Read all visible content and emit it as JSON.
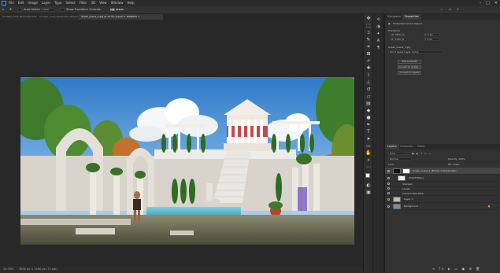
{
  "app": {
    "menu": [
      "File",
      "Edit",
      "Image",
      "Layer",
      "Type",
      "Select",
      "Filter",
      "3D",
      "View",
      "Window",
      "Help"
    ],
    "window_controls": [
      "–",
      "□",
      "✕"
    ]
  },
  "options_bar": {
    "auto_select_label": "Auto-Select:",
    "auto_select_value": "Layer",
    "transform_label": "Show Transform Controls"
  },
  "tabs": [
    {
      "label": "Ancient_ruins_landscape.psd @ 16.7% (Ruins, RGB/8) ×",
      "active": false
    },
    {
      "label": "Ancient_ruins_landscape_02.psd @ 16.7% (Grass, RGB/8) ×",
      "active": false
    },
    {
      "label": "Greek_scene_1.jpg @ 33.3% (Layer 3, RGB/8#) ×",
      "active": true
    }
  ],
  "status_bar": {
    "zoom": "33.33%",
    "doc_info": "3840 px × 2160 px (72 ppi)"
  },
  "toolbar": {
    "tools": [
      "move-icon",
      "marquee-icon",
      "lasso-icon",
      "quick-select-icon",
      "crop-icon",
      "frame-icon",
      "eyedropper-icon",
      "healing-icon",
      "brush-icon",
      "stamp-icon",
      "history-brush-icon",
      "eraser-icon",
      "gradient-icon",
      "blur-icon",
      "dodge-icon",
      "pen-icon",
      "type-icon",
      "path-select-icon",
      "rectangle-icon",
      "hand-icon",
      "zoom-icon"
    ],
    "foreground_color": "#ffffff",
    "background_color": "#000000"
  },
  "properties_panel": {
    "tabs": [
      "Navigator",
      "Properties"
    ],
    "active_tab": "Properties",
    "header": "Embedded Smart Object",
    "section_transform": "Transform",
    "w_value": "W: 3840 px",
    "h_value": "H: 2160 px",
    "x_value": "X: 0 px",
    "y_value": "Y: 0 px",
    "file_link": "Greek_scene_1.jpg",
    "layer_comp": "Don't Apply Layer Comp",
    "buttons": [
      "Edit Contents",
      "Convert to Linked...",
      "Convert to Layers"
    ]
  },
  "layers_panel": {
    "tabs": [
      "Layers",
      "Channels",
      "Paths"
    ],
    "active_tab": "Layers",
    "kind_filter": "Kind",
    "blend_mode": "Normal",
    "opacity": "Opacity: 100%",
    "fill": "Fill: 100%",
    "lock_label": "Lock:",
    "layers": [
      {
        "name": "Greek_scene_1 (Enhanced/Upscaled)",
        "selected": true,
        "type": "smart"
      },
      {
        "name": "Smart Filters",
        "selected": false,
        "type": "filters"
      },
      {
        "name": "Sharpen",
        "selected": false,
        "type": "filter"
      },
      {
        "name": "Levels",
        "selected": false,
        "type": "filter"
      },
      {
        "name": "Camera Raw Filter",
        "selected": false,
        "type": "filter"
      },
      {
        "name": "Layer 1",
        "selected": false,
        "type": "pixel"
      },
      {
        "name": "Background",
        "selected": false,
        "type": "background"
      }
    ]
  },
  "colors": {
    "ui_dark": "#282828",
    "panel": "#323232",
    "accent": "#31a8ff"
  }
}
